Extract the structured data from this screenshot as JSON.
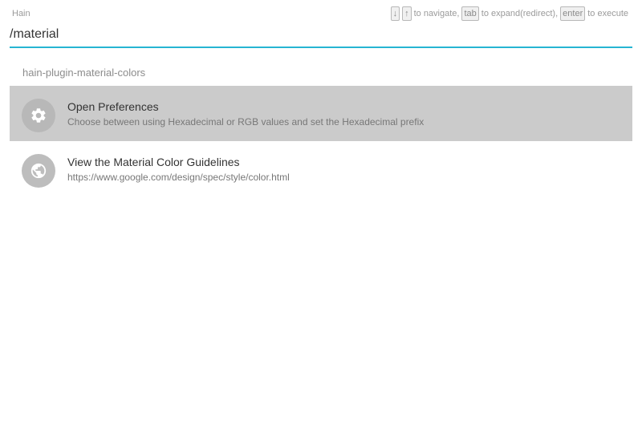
{
  "app": {
    "title": "Hain"
  },
  "hints": {
    "down_key": "↓",
    "up_key": "↑",
    "navigate_text": "to navigate,",
    "tab_key": "tab",
    "expand_text": "to expand(redirect),",
    "enter_key": "enter",
    "execute_text": "to execute"
  },
  "search": {
    "value": "/material"
  },
  "group": {
    "header": "hain-plugin-material-colors"
  },
  "results": [
    {
      "title": "Open Preferences",
      "description": "Choose between using Hexadecimal or RGB values and set the Hexadecimal prefix",
      "icon": "gear-icon",
      "selected": true
    },
    {
      "title": "View the Material Color Guidelines",
      "description": "https://www.google.com/design/spec/style/color.html",
      "icon": "globe-icon",
      "selected": false
    }
  ],
  "colors": {
    "accent": "#26b5d2",
    "selected_bg": "#cbcbcb",
    "icon_bg": "#bdbdbd"
  }
}
